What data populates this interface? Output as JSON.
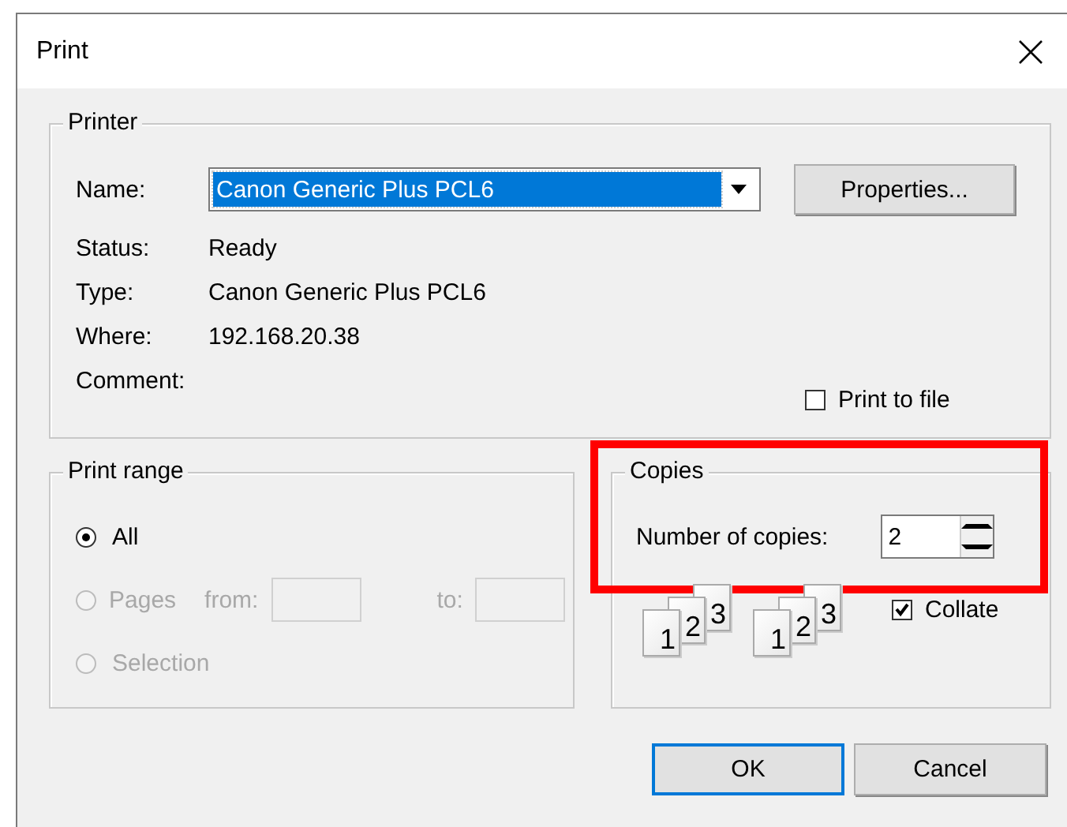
{
  "window": {
    "title": "Print"
  },
  "printer": {
    "title": "Printer",
    "name_label": "Name:",
    "name_value": "Canon Generic Plus PCL6",
    "properties_button": "Properties...",
    "info": [
      {
        "label": "Status:",
        "value": "Ready"
      },
      {
        "label": "Type:",
        "value": "Canon Generic Plus PCL6"
      },
      {
        "label": "Where:",
        "value": "192.168.20.38"
      },
      {
        "label": "Comment:"
      }
    ],
    "print_to_file": {
      "label": "Print to file",
      "checked": false
    }
  },
  "print_range": {
    "title": "Print range",
    "disabled": true,
    "options": [
      {
        "label": "All",
        "selected": true
      },
      {
        "label": "Pages",
        "selected": false,
        "from_label": "from:",
        "to_label": "to:"
      },
      {
        "label": "Selection",
        "selected": false
      }
    ]
  },
  "copies": {
    "title": "Copies",
    "number_label": "Number of copies:",
    "number_value": "2",
    "collate_stacks": [
      [
        "1",
        "2",
        "3"
      ],
      [
        "1",
        "2",
        "3"
      ]
    ],
    "collate": {
      "label": "Collate",
      "checked": true
    }
  },
  "highlight": {
    "copies": true
  },
  "buttons": [
    {
      "label": "OK",
      "default": true
    },
    {
      "label": "Cancel",
      "default": false
    }
  ]
}
